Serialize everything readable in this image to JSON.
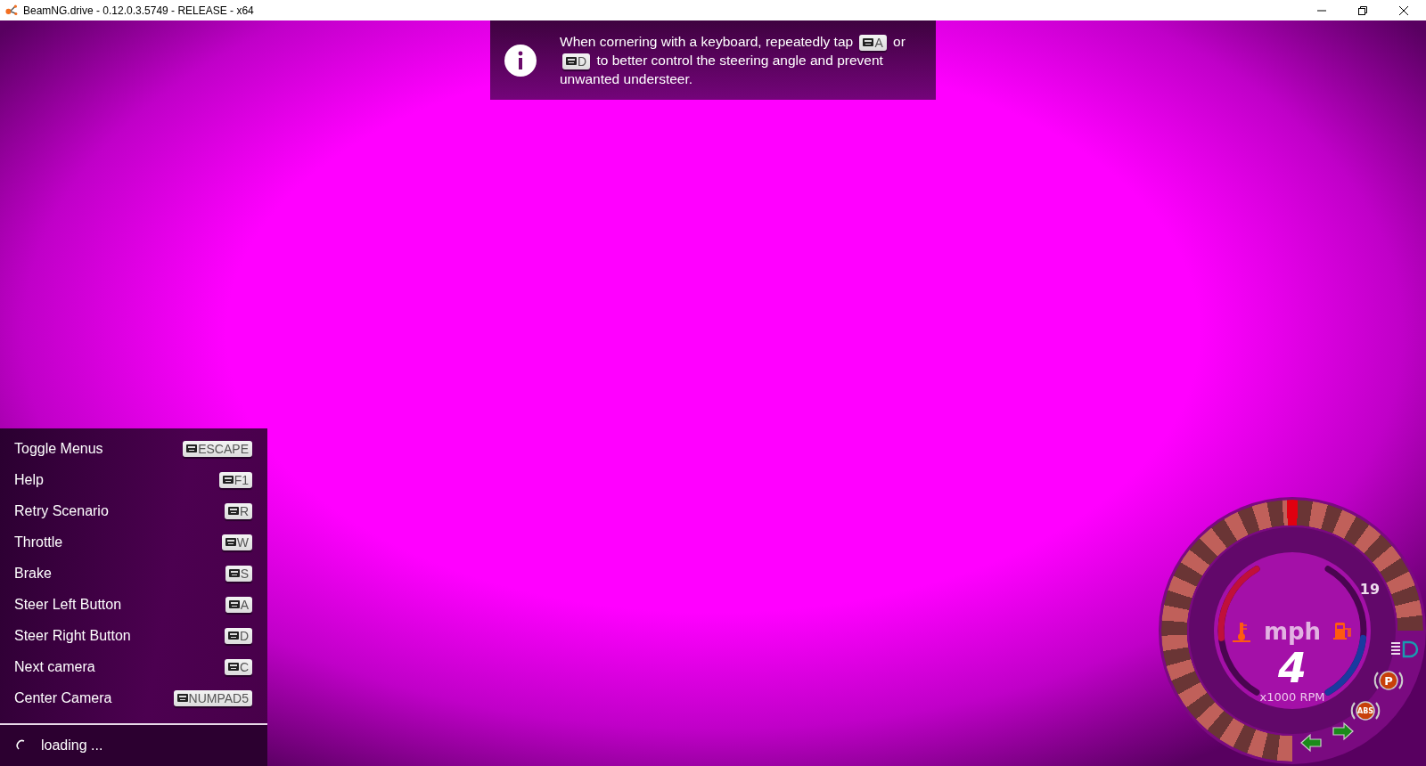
{
  "window": {
    "title": "BeamNG.drive - 0.12.0.3.5749 - RELEASE - x64"
  },
  "tip": {
    "parts": [
      {
        "kind": "text",
        "text": "When cornering with a keyboard, repeatedly tap "
      },
      {
        "kind": "key",
        "text": "A"
      },
      {
        "kind": "text",
        "text": " or "
      },
      {
        "kind": "key",
        "text": "D"
      },
      {
        "kind": "text",
        "text": " to better control the steering angle and prevent unwanted understeer."
      }
    ]
  },
  "bindings": [
    {
      "action": "Toggle Menus",
      "key": "ESCAPE"
    },
    {
      "action": "Help",
      "key": "F1"
    },
    {
      "action": "Retry Scenario",
      "key": "R"
    },
    {
      "action": "Throttle",
      "key": "W"
    },
    {
      "action": "Brake",
      "key": "S"
    },
    {
      "action": "Steer Left Button",
      "key": "A"
    },
    {
      "action": "Steer Right Button",
      "key": "D"
    },
    {
      "action": "Next camera",
      "key": "C"
    },
    {
      "action": "Center Camera",
      "key": "NUMPAD5"
    }
  ],
  "status": {
    "text": "loading ..."
  },
  "dashboard": {
    "unit": "mph",
    "speed": "4",
    "rpm_label": "x1000 RPM",
    "gear": "19",
    "parking_label": "P",
    "abs_label": "ABS",
    "temperature": {
      "level": 0.55
    },
    "fuel": {
      "level": 0.45
    }
  }
}
